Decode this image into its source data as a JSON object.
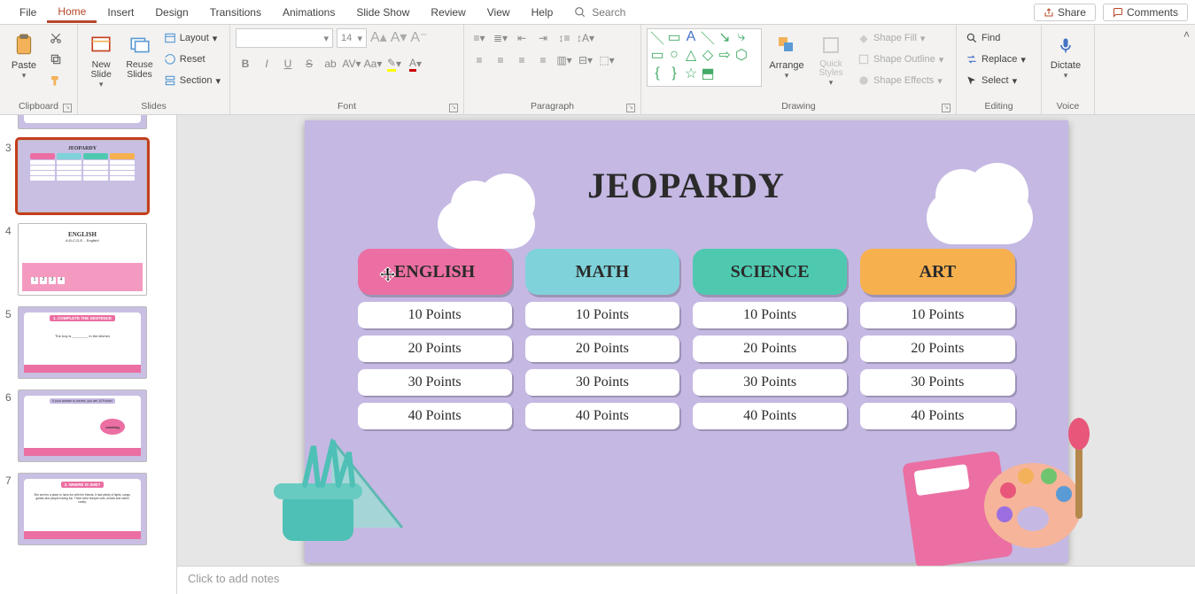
{
  "menu": {
    "items": [
      "File",
      "Home",
      "Insert",
      "Design",
      "Transitions",
      "Animations",
      "Slide Show",
      "Review",
      "View",
      "Help"
    ],
    "active_index": 1,
    "search_placeholder": "Search",
    "share": "Share",
    "comments": "Comments"
  },
  "ribbon": {
    "clipboard": {
      "label": "Clipboard",
      "paste": "Paste"
    },
    "slides": {
      "label": "Slides",
      "new_slide": "New Slide",
      "reuse": "Reuse Slides",
      "layout": "Layout",
      "reset": "Reset",
      "section": "Section"
    },
    "font": {
      "label": "Font",
      "size": "14"
    },
    "paragraph": {
      "label": "Paragraph"
    },
    "drawing": {
      "label": "Drawing",
      "arrange": "Arrange",
      "quick": "Quick Styles",
      "fill": "Shape Fill",
      "outline": "Shape Outline",
      "effects": "Shape Effects"
    },
    "editing": {
      "label": "Editing",
      "find": "Find",
      "replace": "Replace",
      "select": "Select"
    },
    "voice": {
      "label": "Voice",
      "dictate": "Dictate"
    }
  },
  "slide_panel": {
    "visible_numbers": [
      3,
      4,
      5,
      6,
      7
    ],
    "selected": 3,
    "s3": {
      "title": "JEOPARDY"
    },
    "s4": {
      "title": "ENGLISH",
      "sub": "A-B-C-D-E... English!"
    },
    "s5": {
      "title": "1. COMPLETE THE SENTENCE",
      "body": "The boy is ________ in the kitchen"
    },
    "s6": {
      "title": "If your answer is correct, you win 10 Points!",
      "badge": "cooking"
    },
    "s7": {
      "title": "2. WHERE IS SHE?",
      "body": "She went to a place to have fun with her friends. It had plenty of lights, songs, games and people having fun. There were bumper cars, donuts and cotton candy."
    }
  },
  "slide": {
    "title": "JEOPARDY",
    "categories": [
      "ENGLISH",
      "MATH",
      "SCIENCE",
      "ART"
    ],
    "points": [
      "10 Points",
      "20 Points",
      "30 Points",
      "40 Points"
    ]
  },
  "chart_data": {
    "type": "table",
    "title": "JEOPARDY",
    "columns": [
      "ENGLISH",
      "MATH",
      "SCIENCE",
      "ART"
    ],
    "rows": [
      [
        "10 Points",
        "10 Points",
        "10 Points",
        "10 Points"
      ],
      [
        "20 Points",
        "20 Points",
        "20 Points",
        "20 Points"
      ],
      [
        "30 Points",
        "30 Points",
        "30 Points",
        "30 Points"
      ],
      [
        "40 Points",
        "40 Points",
        "40 Points",
        "40 Points"
      ]
    ]
  },
  "notes": {
    "placeholder": "Click to add notes"
  }
}
